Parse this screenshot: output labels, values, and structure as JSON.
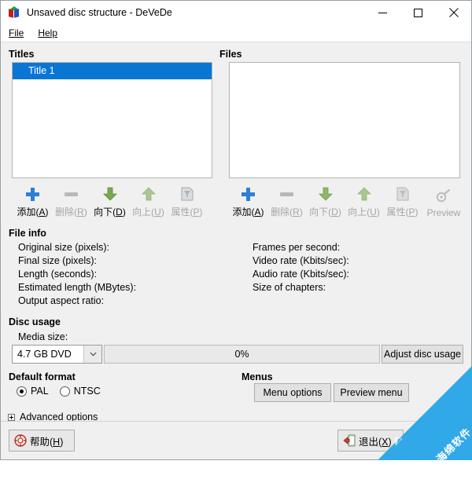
{
  "window": {
    "title": "Unsaved disc structure - DeVeDe",
    "app_icon": "cube-icon",
    "controls": {
      "minimize": "minimize-icon",
      "maximize": "maximize-icon",
      "close": "close-icon"
    }
  },
  "menubar": {
    "items": [
      {
        "label": "File",
        "mnemonic": "F"
      },
      {
        "label": "Help",
        "mnemonic": "H"
      }
    ]
  },
  "titles_panel": {
    "heading": "Titles",
    "items": [
      {
        "label": "Title 1",
        "selected": true
      }
    ],
    "toolbar": [
      {
        "name": "add",
        "label_pre": "添加(",
        "label_key": "A",
        "label_post": ")",
        "icon": "plus-icon",
        "enabled": true
      },
      {
        "name": "remove",
        "label_pre": "删除(",
        "label_key": "R",
        "label_post": ")",
        "icon": "minus-icon",
        "enabled": false
      },
      {
        "name": "move-down",
        "label_pre": "向下(",
        "label_key": "D",
        "label_post": ")",
        "icon": "arrow-down-icon",
        "enabled": true
      },
      {
        "name": "move-up",
        "label_pre": "向上(",
        "label_key": "U",
        "label_post": ")",
        "icon": "arrow-up-icon",
        "enabled": false
      },
      {
        "name": "properties",
        "label_pre": "属性(",
        "label_key": "P",
        "label_post": ")",
        "icon": "properties-icon",
        "enabled": false
      }
    ]
  },
  "files_panel": {
    "heading": "Files",
    "items": [],
    "toolbar": [
      {
        "name": "add",
        "label_pre": "添加(",
        "label_key": "A",
        "label_post": ")",
        "icon": "plus-icon",
        "enabled": true
      },
      {
        "name": "remove",
        "label_pre": "删除(",
        "label_key": "R",
        "label_post": ")",
        "icon": "minus-icon",
        "enabled": false
      },
      {
        "name": "move-down",
        "label_pre": "向下(",
        "label_key": "D",
        "label_post": ")",
        "icon": "arrow-down-icon",
        "enabled": false
      },
      {
        "name": "move-up",
        "label_pre": "向上(",
        "label_key": "U",
        "label_post": ")",
        "icon": "arrow-up-icon",
        "enabled": false
      },
      {
        "name": "properties",
        "label_pre": "属性(",
        "label_key": "P",
        "label_post": ")",
        "icon": "properties-icon",
        "enabled": false
      },
      {
        "name": "preview",
        "label_pre": "Preview",
        "label_key": "",
        "label_post": "",
        "icon": "preview-icon",
        "enabled": false
      }
    ]
  },
  "file_info": {
    "heading": "File info",
    "left": [
      {
        "label": "Original size (pixels):",
        "value": ""
      },
      {
        "label": "Final size (pixels):",
        "value": ""
      },
      {
        "label": "Length (seconds):",
        "value": ""
      },
      {
        "label": "Estimated length (MBytes):",
        "value": ""
      },
      {
        "label": "Output aspect ratio:",
        "value": ""
      }
    ],
    "right": [
      {
        "label": "Frames per second:",
        "value": ""
      },
      {
        "label": "Video rate (Kbits/sec):",
        "value": ""
      },
      {
        "label": "Audio rate (Kbits/sec):",
        "value": ""
      },
      {
        "label": "Size of chapters:",
        "value": ""
      }
    ]
  },
  "disc_usage": {
    "heading": "Disc usage",
    "media_size_label": "Media size:",
    "media_size_value": "4.7 GB DVD",
    "progress_text": "0%",
    "progress_percent": 0,
    "adjust_button": "Adjust disc usage"
  },
  "default_format": {
    "heading": "Default format",
    "options": [
      {
        "label": "PAL",
        "checked": true
      },
      {
        "label": "NTSC",
        "checked": false
      }
    ]
  },
  "menus_group": {
    "heading": "Menus",
    "buttons": [
      {
        "label": "Menu options"
      },
      {
        "label": "Preview menu"
      }
    ]
  },
  "advanced": {
    "label": "Advanced options",
    "expanded": false
  },
  "bottom_bar": {
    "help_pre": "帮助(",
    "help_key": "H",
    "help_post": ")",
    "exit_pre": "退出(",
    "exit_key": "X",
    "exit_post": ")"
  },
  "watermark": {
    "text": "海绵软件",
    "color": "#31a8e8"
  },
  "colors": {
    "selection": "#0a76d4",
    "window_bg": "#f0f0f0",
    "accent_plus": "#2e7fd4",
    "arrow_green": "#7aa84f"
  }
}
